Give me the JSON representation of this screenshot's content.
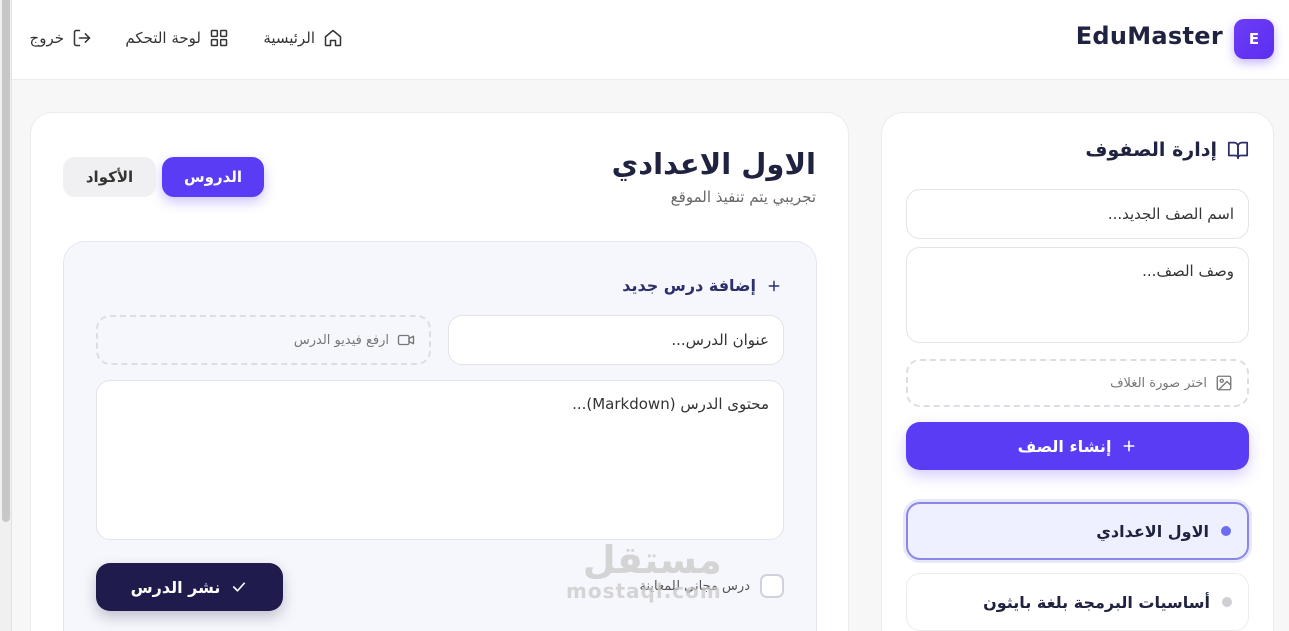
{
  "header": {
    "logo_letter": "E",
    "brand": "EduMaster",
    "nav": {
      "home": "الرئيسية",
      "dashboard": "لوحة التحكم",
      "logout": "خروج"
    }
  },
  "classes_panel": {
    "title": "إدارة الصفوف",
    "name_placeholder": "اسم الصف الجديد...",
    "desc_placeholder": "وصف الصف...",
    "cover_label": "اختر صورة الغلاف",
    "create_button": "إنشاء الصف",
    "items": [
      {
        "label": "الاول الاعدادي",
        "dot_color": "#6c6cf0",
        "active": true
      },
      {
        "label": "أساسيات البرمجة بلغة بايثون",
        "dot_color": "#cfcfd6",
        "active": false
      }
    ]
  },
  "course": {
    "title": "الاول الاعدادي",
    "subtitle": "تجريبي يتم تنفيذ الموقع",
    "tabs": {
      "lessons": "الدروس",
      "codes": "الأكواد"
    }
  },
  "lesson_form": {
    "title": "إضافة درس جديد",
    "title_placeholder": "عنوان الدرس...",
    "video_label": "ارفع فيديو الدرس",
    "content_placeholder": "محتوى الدرس (Markdown)...",
    "free_preview_label": "درس مجاني للمعاينة",
    "publish_button": "نشر الدرس"
  },
  "watermark": {
    "arabic": "مستقل",
    "latin": "mostaql.com"
  },
  "colors": {
    "primary": "#5b3cf5",
    "dark": "#1f1b4d",
    "accent_dot": "#6c6cf0"
  }
}
